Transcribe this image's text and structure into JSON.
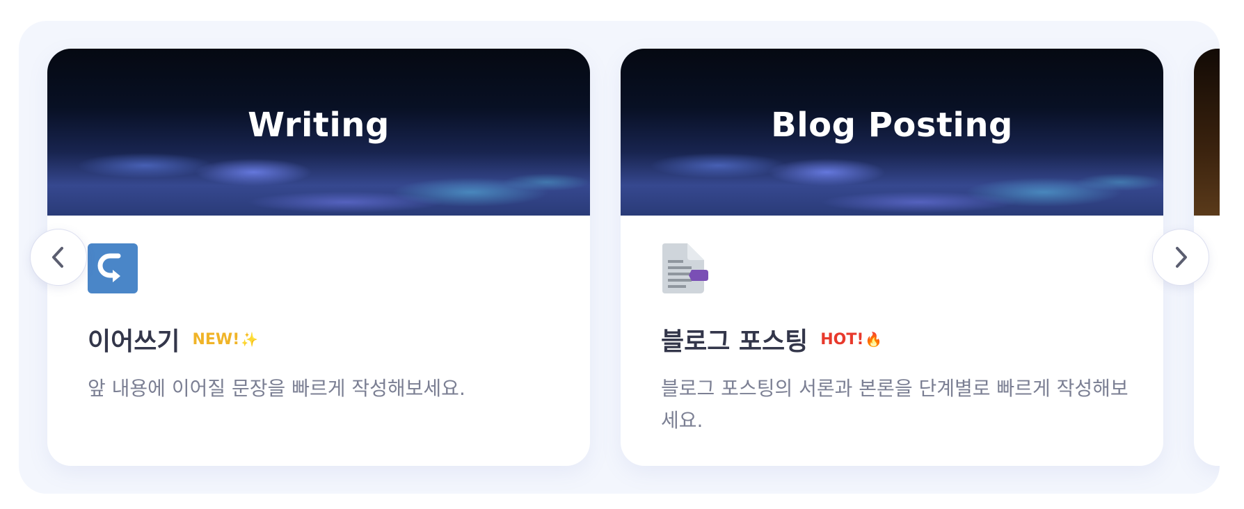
{
  "carousel": {
    "cards": [
      {
        "banner_title": "Writing",
        "icon": "continue-writing-icon",
        "title": "이어쓰기",
        "badge": "NEW!",
        "badge_glyph": "✨",
        "description": "앞 내용에 이어질 문장을 빠르게 작성해보세요."
      },
      {
        "banner_title": "Blog Posting",
        "icon": "document-tag-icon",
        "title": "블로그 포스팅",
        "badge": "HOT!",
        "badge_glyph": "🔥",
        "description": "블로그 포스팅의 서론과 본론을 단계별로 빠르게 작성해보세요."
      }
    ],
    "prev_icon": "chevron-left-icon",
    "next_icon": "chevron-right-icon"
  },
  "colors": {
    "panel_bg": "#f3f6fd",
    "icon_blue": "#4a86c8",
    "badge_new": "#f0b428",
    "badge_hot": "#e8392c",
    "title_text": "#33364a",
    "desc_text": "#7b7f93"
  }
}
